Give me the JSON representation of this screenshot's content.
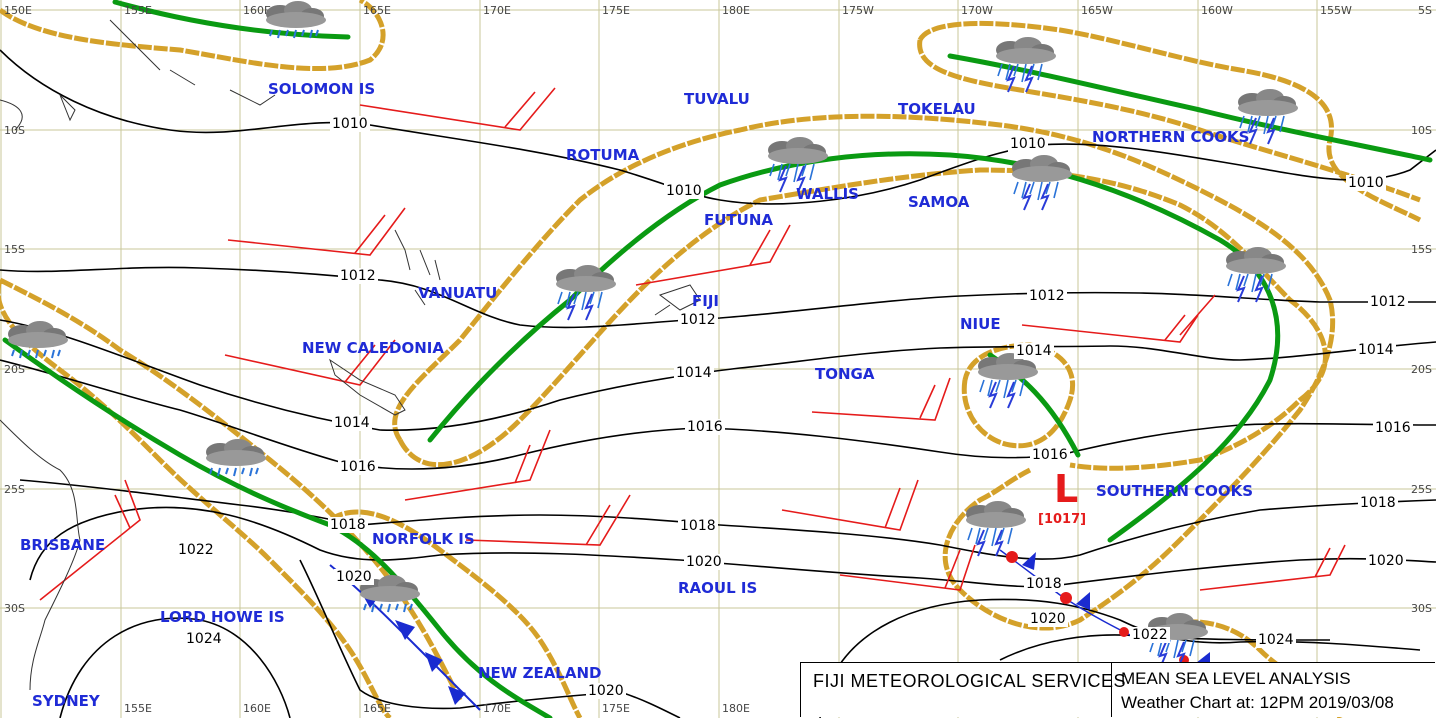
{
  "longitudes": [
    "150E",
    "155E",
    "160E",
    "165E",
    "170E",
    "175E",
    "180E",
    "175W",
    "170W",
    "165W",
    "160W",
    "155W"
  ],
  "latitudes": [
    "10S",
    "15S",
    "20S",
    "25S",
    "30S"
  ],
  "right_lat": [
    "5S",
    "10S",
    "15S",
    "20S",
    "25S",
    "30S"
  ],
  "places": {
    "solomon": "SOLOMON IS",
    "tuvalu": "TUVALU",
    "tokelau": "TOKELAU",
    "northern_cooks": "NORTHERN COOKS",
    "rotuma": "ROTUMA",
    "wallis": "WALLIS",
    "futuna": "FUTUNA",
    "samoa": "SAMOA",
    "vanuatu": "VANUATU",
    "fiji": "FIJI",
    "niue": "NIUE",
    "new_caledonia": "NEW CALEDONIA",
    "tonga": "TONGA",
    "southern_cooks": "SOUTHERN COOKS",
    "brisbane": "BRISBANE",
    "norfolk": "NORFOLK IS",
    "raoul": "RAOUL IS",
    "lord_howe": "LORD HOWE IS",
    "new_zealand": "NEW ZEALAND",
    "sydney": "SYDNEY"
  },
  "isobars": {
    "a": "1010",
    "b": "1010",
    "c": "1010",
    "d": "1010",
    "e": "1012",
    "f": "1012",
    "g": "1012",
    "h": "1012",
    "i": "1014",
    "j": "1014",
    "k": "1014",
    "l": "1014",
    "m": "1016",
    "n": "1016",
    "o": "1016",
    "p": "1016",
    "q": "1018",
    "r": "1018",
    "s": "1018",
    "t": "1018",
    "u": "1020",
    "v": "1020",
    "w": "1020",
    "x": "1020",
    "y": "1020",
    "z": "1022",
    "aa": "1022",
    "ab": "1024",
    "ac": "1024"
  },
  "low": {
    "symbol": "L",
    "value": "[1017]",
    "color": "#e51b1b"
  },
  "colors": {
    "trough": "#0a9a12",
    "cloud": "#d4a12a",
    "label": "#1f2bd6",
    "wind": "#e51b1b",
    "isobar": "#000000",
    "grid": "#c9c79a"
  },
  "icons": [
    "thunderstorm-cloud-icon",
    "shower-cloud-icon",
    "cold-front-icon",
    "wind-barb-icon"
  ],
  "info": {
    "agency": "FIJI METEOROLOGICAL SERVICES",
    "title": "MEAN SEA LEVEL ANALYSIS",
    "chart_time": "Weather Chart at: 12PM  2019/03/08"
  }
}
